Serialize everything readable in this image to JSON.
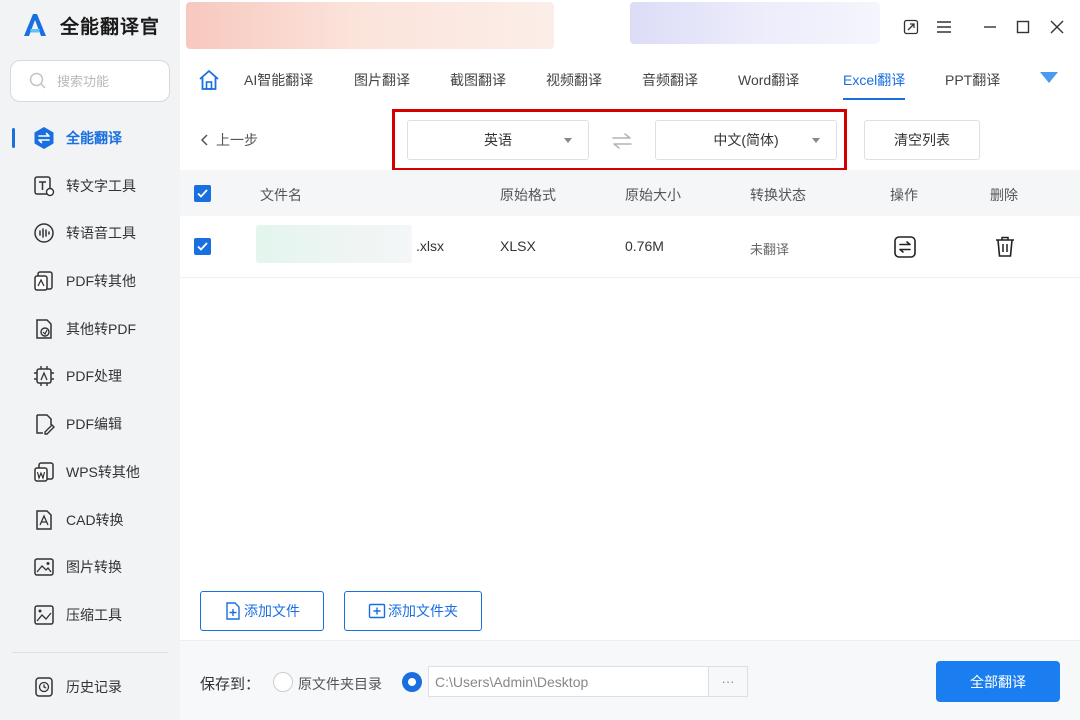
{
  "app": {
    "title": "全能翻译官"
  },
  "search": {
    "placeholder": "搜索功能"
  },
  "sidebar": {
    "items": [
      {
        "label": "全能翻译",
        "icon": "translate-hex-icon",
        "active": true
      },
      {
        "label": "转文字工具",
        "icon": "text-convert-icon"
      },
      {
        "label": "转语音工具",
        "icon": "voice-convert-icon"
      },
      {
        "label": "PDF转其他",
        "icon": "pdf-export-icon"
      },
      {
        "label": "其他转PDF",
        "icon": "pdf-import-icon"
      },
      {
        "label": "PDF处理",
        "icon": "pdf-process-icon"
      },
      {
        "label": "PDF编辑",
        "icon": "pdf-edit-icon"
      },
      {
        "label": "WPS转其他",
        "icon": "wps-convert-icon"
      },
      {
        "label": "CAD转换",
        "icon": "cad-convert-icon"
      },
      {
        "label": "图片转换",
        "icon": "image-convert-icon"
      },
      {
        "label": "压缩工具",
        "icon": "compress-icon"
      }
    ],
    "history": {
      "label": "历史记录",
      "icon": "history-icon"
    }
  },
  "tabs": [
    {
      "label": "AI智能翻译"
    },
    {
      "label": "图片翻译"
    },
    {
      "label": "截图翻译"
    },
    {
      "label": "视频翻译"
    },
    {
      "label": "音频翻译"
    },
    {
      "label": "Word翻译"
    },
    {
      "label": "Excel翻译",
      "active": true
    },
    {
      "label": "PPT翻译"
    }
  ],
  "toolbar": {
    "back_label": "上一步",
    "source_language": "英语",
    "target_language": "中文(简体)",
    "clear_label": "清空列表"
  },
  "table": {
    "columns": [
      "文件名",
      "原始格式",
      "原始大小",
      "转换状态",
      "操作",
      "删除"
    ],
    "rows": [
      {
        "file_ext": ".xlsx",
        "format": "XLSX",
        "size": "0.76M",
        "status": "未翻译"
      }
    ]
  },
  "actions": {
    "add_file_label": "添加文件",
    "add_folder_label": "添加文件夹"
  },
  "footer": {
    "save_to_label": "保存到：",
    "origin_folder_label": "原文件夹目录",
    "output_path": "C:\\Users\\Admin\\Desktop",
    "browse_label": "···",
    "translate_all_label": "全部翻译"
  },
  "colors": {
    "accent": "#1a6fe0",
    "highlight": "#d40000",
    "sidebar_bg": "#f2f3f5"
  }
}
